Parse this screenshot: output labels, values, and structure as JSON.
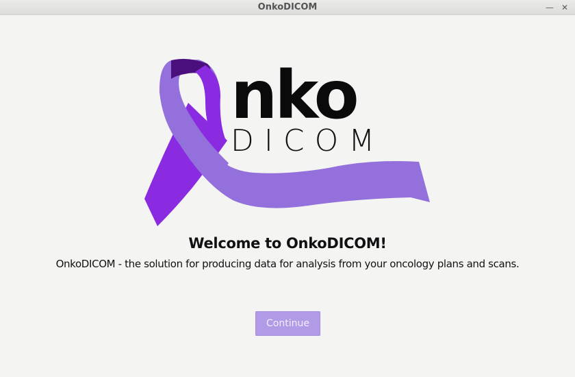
{
  "window": {
    "title": "OnkoDICOM"
  },
  "logo": {
    "word_top": "nko",
    "word_bottom": "DICOM",
    "ribbon_colors": {
      "dark": "#4b0f7d",
      "mid": "#8a2be2",
      "light": "#9370db"
    }
  },
  "main": {
    "heading": "Welcome to OnkoDICOM!",
    "description": "OnkoDICOM - the solution for producing data for analysis from your oncology plans and scans.",
    "continue_label": "Continue"
  },
  "colors": {
    "background": "#f4f5f3",
    "button_bg": "#b19ae6",
    "button_text": "#f2eefc"
  }
}
